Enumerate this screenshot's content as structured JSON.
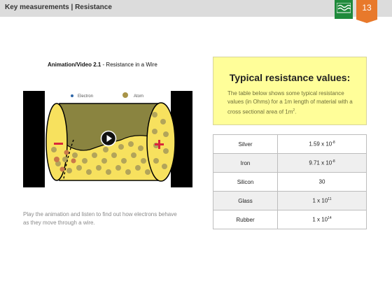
{
  "header": {
    "breadcrumb": "Key measurements  |  Resistance",
    "page_number": "13",
    "logo_color": "#1f8a3b",
    "page_badge_color": "#e8792b"
  },
  "media": {
    "caption_bold": "Animation/Video 2.1",
    "caption_rest": " - Resistance in a Wire",
    "legend_electron": "Electron",
    "legend_atom": "Atom",
    "play_icon": "play-icon",
    "description": "Play the animation and listen to find out how electrons behave as they move through a wire."
  },
  "info_box": {
    "title": "Typical resistance values:",
    "body_prefix": "The table below shows some typical resistance values (in Ohms) for a 1m length of material with a cross sectional area of 1m",
    "body_exponent": "2",
    "body_suffix": "."
  },
  "table": {
    "rows": [
      {
        "material": "Silver",
        "mantissa": "1.59 x 10",
        "exponent": "-8"
      },
      {
        "material": "Iron",
        "mantissa": "9.71 x 10",
        "exponent": "-8"
      },
      {
        "material": "Silicon",
        "mantissa": "30",
        "exponent": ""
      },
      {
        "material": "Glass",
        "mantissa": "1 x 10",
        "exponent": "11"
      },
      {
        "material": "Rubber",
        "mantissa": "1 x 10",
        "exponent": "14"
      }
    ]
  }
}
